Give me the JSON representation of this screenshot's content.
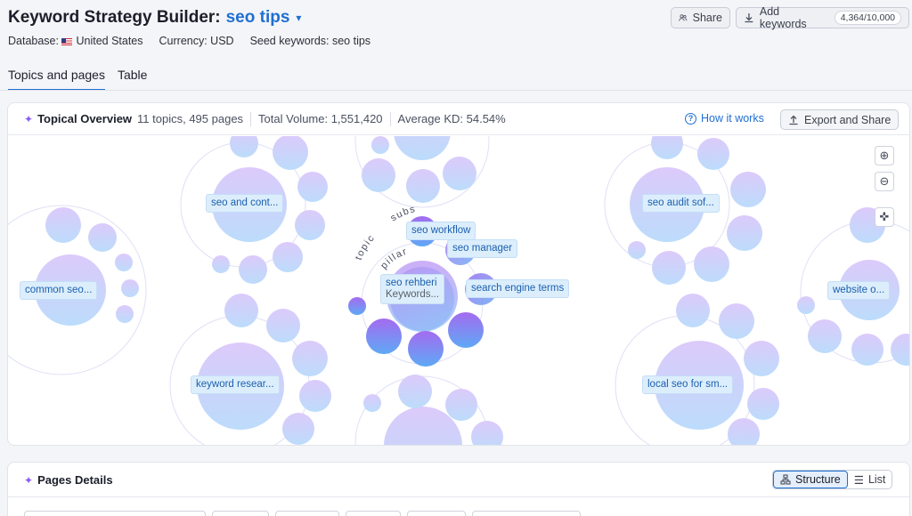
{
  "header": {
    "title_prefix": "Keyword Strategy Builder:",
    "keyword": "seo tips",
    "chevron": "▾",
    "database_label": "Database:",
    "database_value": "United States",
    "currency": "Currency: USD",
    "seed": "Seed keywords: seo tips",
    "share_label": "Share",
    "add_keywords_label": "Add keywords",
    "keyword_limit": "4,364/10,000"
  },
  "tabs": [
    {
      "label": "Topics and pages",
      "active": true
    },
    {
      "label": "Table",
      "active": false
    }
  ],
  "overview": {
    "title": "Topical Overview",
    "topics": "11 topics, 495 pages",
    "volume": "Total Volume: 1,551,420",
    "kd": "Average KD: 54.54%",
    "how_it_works": "How it works",
    "export_label": "Export and Share",
    "center_word_topic": "topic",
    "center_word_subs": "subs",
    "center_word_pillar": "pillar",
    "labels": {
      "seo_content": "seo and cont...",
      "common_seo": "common seo...",
      "keyword_research": "keyword resear...",
      "seo_audit": "seo audit sof...",
      "website": "website o...",
      "local_seo": "local seo for sm...",
      "seo_workflow": "seo workflow",
      "seo_manager": "seo manager",
      "seo_rehberi": "seo rehberi",
      "keywords_sub": "Keywords...",
      "search_engine_terms": "search engine terms"
    }
  },
  "pages_details": {
    "title": "Pages Details",
    "structure_label": "Structure",
    "list_label": "List"
  },
  "icons": {
    "zoom_in": "zoom-in-icon",
    "zoom_out": "zoom-out-icon",
    "recenter": "recenter-icon",
    "share": "users-icon",
    "download": "download-icon",
    "export": "upload-icon",
    "sparkle": "sparkle-icon",
    "help": "question-circle-icon"
  },
  "colors": {
    "accent": "#1f6fd1",
    "bubble_top": "#d9c9fb",
    "bubble_bottom": "#bfdcfb",
    "pillar_top": "#a56af0",
    "pillar_bottom": "#5fa8f5"
  }
}
